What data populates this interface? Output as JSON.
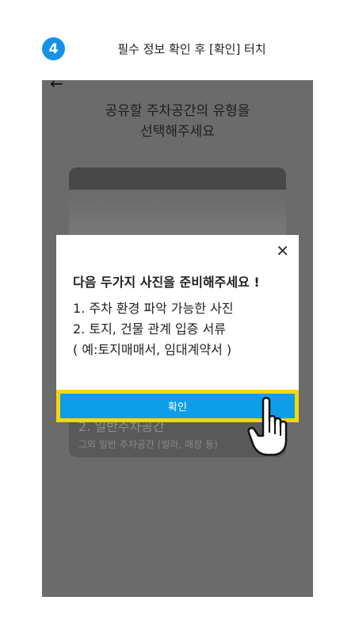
{
  "step": {
    "number": "4",
    "instruction": "필수 정보 확인 후 [확인] 터치"
  },
  "screen": {
    "back_label": "←",
    "heading_line1": "공유할 주차공간의 유형을",
    "heading_line2": "선택해주세요",
    "card2_title": "2. 일반주차공간",
    "card2_sub": "그외 일반 주차공간 (빌라, 매장 등)"
  },
  "modal": {
    "close_label": "✕",
    "title": "다음 두가지 사진을 준비해주세요 !",
    "items": [
      "1. 주차 환경 파악 가능한 사진",
      "2. 토지, 건물 관계 입증 서류",
      "( 예:토지매매서, 임대계약서 )"
    ],
    "confirm_label": "확인"
  },
  "colors": {
    "accent": "#0e9de7",
    "highlight": "#f7d70c",
    "badge": "#1591e8",
    "overlay": "#6b6b6b"
  },
  "icons": {
    "hand": "pointing-hand-icon"
  }
}
